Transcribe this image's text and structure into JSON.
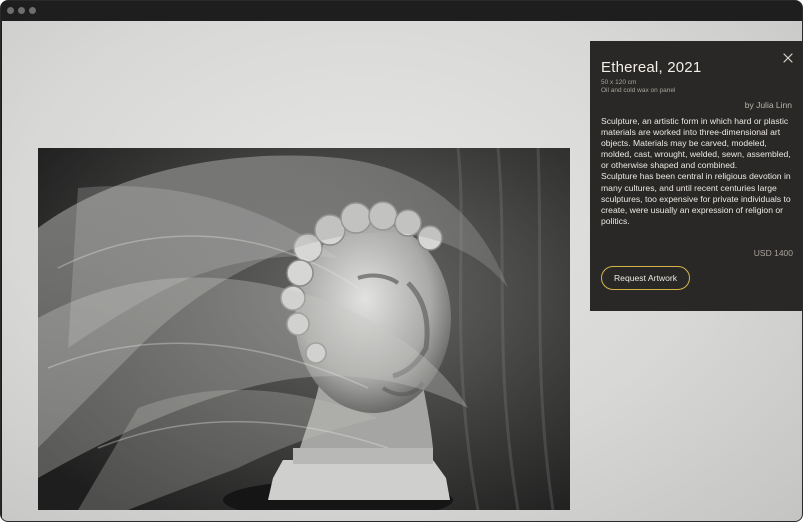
{
  "window": {
    "controls": [
      "close",
      "minimize",
      "maximize"
    ]
  },
  "artwork": {
    "image": "sculpture-bust-wrapped-in-plastic"
  },
  "panel": {
    "title": "Ethereal, 2021",
    "dimensions": "50 x 120 cm",
    "medium": "Oil and cold wax on panel",
    "artist": "by Julia Linn",
    "description": [
      "Sculpture, an artistic form in which hard or plastic materials are worked into three-dimensional art objects. Materials may be carved, modeled, molded, cast, wrought, welded, sewn, assembled, or otherwise shaped and combined.",
      "Sculpture has been central in religious devotion in many cultures, and until recent centuries large sculptures, too expensive for private individuals to create, were usually an expression of religion or politics."
    ],
    "price": "USD 1400",
    "request_label": "Request Artwork",
    "close_icon": "close-icon",
    "accent": "#d4b54a"
  }
}
